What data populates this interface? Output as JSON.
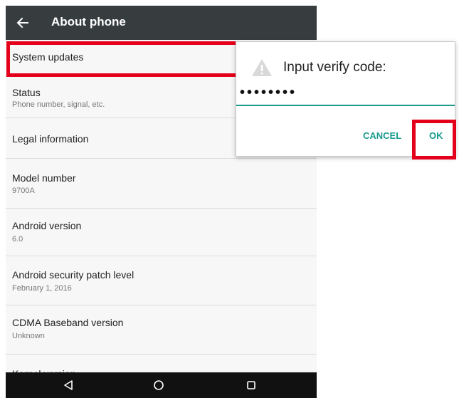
{
  "appbar": {
    "title": "About phone",
    "back_icon": "arrow-back-icon"
  },
  "settings_items": [
    {
      "title": "System updates",
      "subtitle": ""
    },
    {
      "title": "Status",
      "subtitle": "Phone number, signal, etc."
    },
    {
      "title": "Legal information",
      "subtitle": ""
    },
    {
      "title": "Model number",
      "subtitle": "9700A"
    },
    {
      "title": "Android version",
      "subtitle": "6.0"
    },
    {
      "title": "Android security patch level",
      "subtitle": "February 1, 2016"
    },
    {
      "title": "CDMA Baseband version",
      "subtitle": "Unknown"
    },
    {
      "title": "Kernel version",
      "subtitle": ""
    }
  ],
  "dialog": {
    "title": "Input verify code:",
    "icon": "warning-icon",
    "input_value": "••••••••",
    "cancel_label": "CANCEL",
    "ok_label": "OK"
  },
  "navbar": {
    "back_icon": "nav-back-icon",
    "home_icon": "nav-home-icon",
    "recents_icon": "nav-recents-icon"
  },
  "colors": {
    "appbar": "#373d3f",
    "accent": "#1a9b8c",
    "highlight": "#e4001b",
    "navbar": "#111111"
  }
}
